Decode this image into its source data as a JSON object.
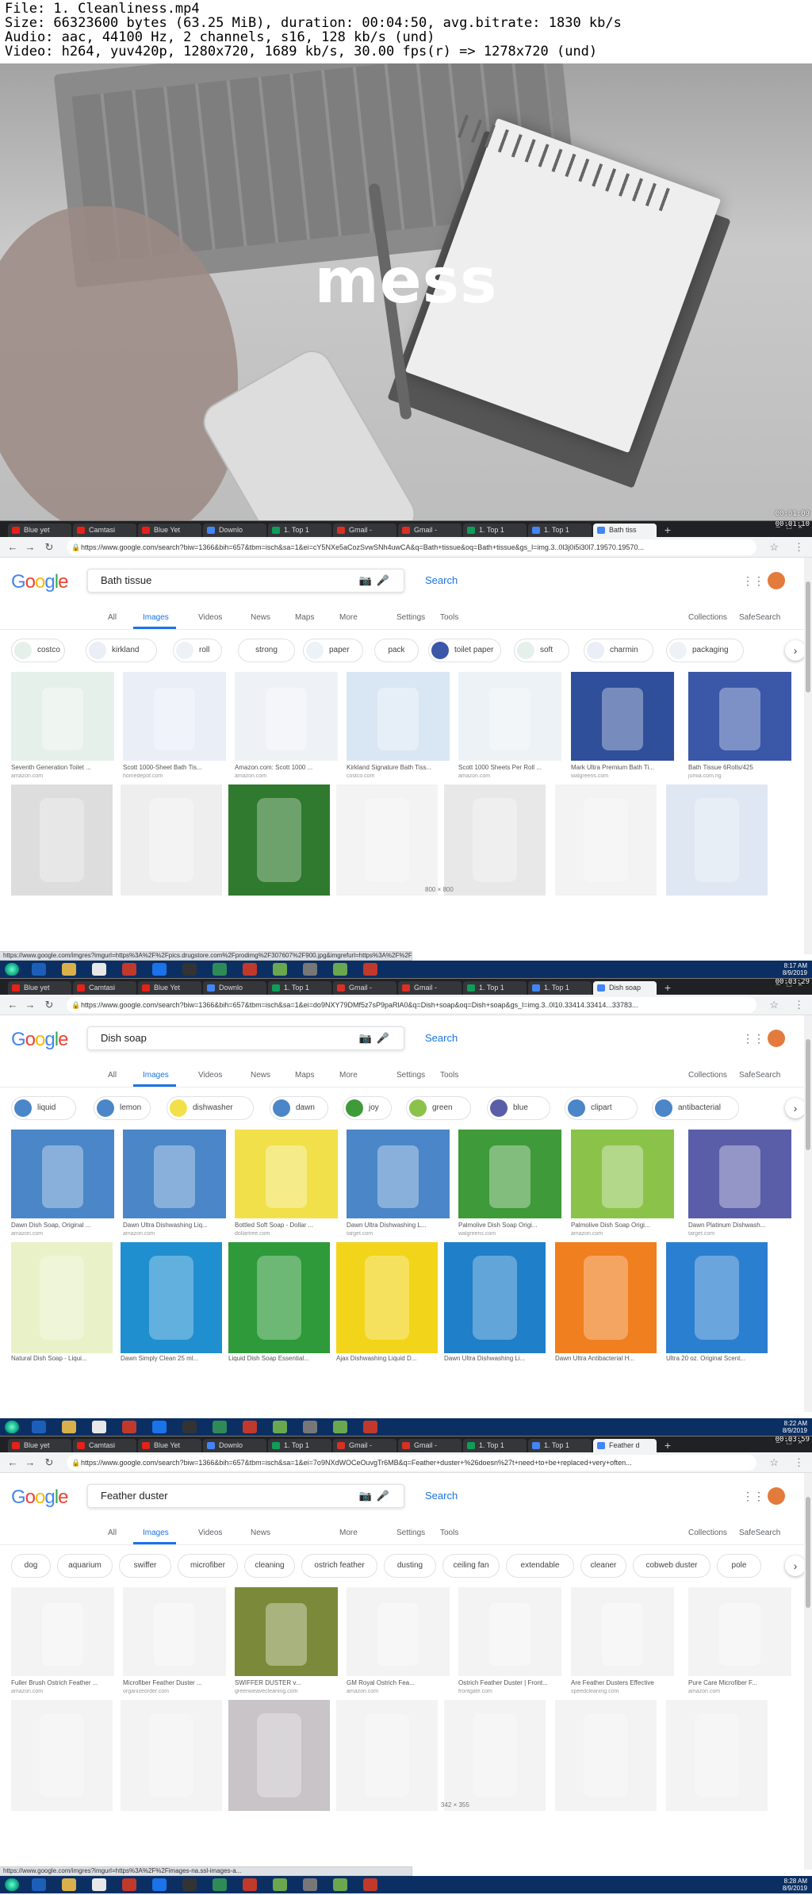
{
  "file_info": {
    "line1": "File: 1. Cleanliness.mp4",
    "line2": "Size: 66323600 bytes (63.25 MiB), duration: 00:04:50, avg.bitrate: 1830 kb/s",
    "line3": "Audio: aac, 44100 Hz, 2 channels, s16, 128 kb/s (und)",
    "line4": "Video: h264, yuv420p, 1280x720, 1689 kb/s, 30.00 fps(r) => 1278x720 (und)"
  },
  "hero": {
    "word": "mess",
    "timestamp": "00:01:09"
  },
  "panels": [
    {
      "timestamp": "00:01:10",
      "tabs": [
        "Blue yet",
        "Camtasi",
        "Blue Yet",
        "Downlo",
        "1. Top 1",
        "Gmail -",
        "Gmail -",
        "1. Top 1",
        "1. Top 1",
        "Bath tiss"
      ],
      "url": "https://www.google.com/search?biw=1366&bih=657&tbm=isch&sa=1&ei=cY5NXe5aCozSvwSNh4uwCA&q=Bath+tissue&oq=Bath+tissue&gs_l=img.3..0l3j0i5i30l7.19570.19570...",
      "query": "Bath tissue",
      "search": "Search",
      "nav": {
        "all": "All",
        "images": "Images",
        "videos": "Videos",
        "news": "News",
        "maps": "Maps",
        "more": "More",
        "settings": "Settings",
        "tools": "Tools",
        "collections": "Collections",
        "safesearch": "SafeSearch"
      },
      "chips": [
        "costco",
        "kirkland",
        "roll",
        "strong",
        "paper",
        "pack",
        "toilet paper",
        "soft",
        "charmin",
        "packaging"
      ],
      "row1": [
        {
          "cap": "Seventh Generation Toilet ...",
          "src": "amazon.com"
        },
        {
          "cap": "Scott 1000-Sheet Bath Tis...",
          "src": "homedepot.com"
        },
        {
          "cap": "Amazon.com: Scott 1000 ...",
          "src": "amazon.com"
        },
        {
          "cap": "Kirkland Signature Bath Tiss...",
          "src": "costco.com"
        },
        {
          "cap": "Scott 1000 Sheets Per Roll ...",
          "src": "amazon.com"
        },
        {
          "cap": "Mark Ultra Premium Bath Ti...",
          "src": "walgreens.com"
        },
        {
          "cap": "Bath Tissue 6Rolls/425",
          "src": "jumia.com.ng"
        }
      ],
      "hover_size": "800 × 800",
      "status": "https://www.google.com/imgres?imgurl=https%3A%2F%2Fpics.drugstore.com%2Fprodimg%2F307607%2F900.jpg&imgrefurl=https%3A%2F%2Fwww.walgreens.com%2Fstore%2Fc%2Fscott-1000-sheets-per-roll-toilet-paper-bath-tissue%2FID%3Dprod",
      "clock_time": "8:17 AM",
      "clock_date": "8/9/2019"
    },
    {
      "timestamp": "00:03:29",
      "tabs": [
        "Blue yet",
        "Camtasi",
        "Blue Yet",
        "Downlo",
        "1. Top 1",
        "Gmail -",
        "Gmail -",
        "1. Top 1",
        "1. Top 1",
        "Dish soap"
      ],
      "url": "https://www.google.com/search?biw=1366&bih=657&tbm=isch&sa=1&ei=do9NXY79DMf5z7sP9paRlA0&q=Dish+soap&oq=Dish+soap&gs_l=img.3..0l10.33414.33414...33783...",
      "query": "Dish soap",
      "search": "Search",
      "nav": {
        "all": "All",
        "images": "Images",
        "videos": "Videos",
        "news": "News",
        "maps": "Maps",
        "more": "More",
        "settings": "Settings",
        "tools": "Tools",
        "collections": "Collections",
        "safesearch": "SafeSearch"
      },
      "chips": [
        "liquid",
        "lemon",
        "dishwasher",
        "dawn",
        "joy",
        "green",
        "blue",
        "clipart",
        "antibacterial"
      ],
      "row1": [
        {
          "cap": "Dawn Dish Soap, Original ...",
          "src": "amazon.com"
        },
        {
          "cap": "Dawn Ultra Dishwashing Liq...",
          "src": "amazon.com"
        },
        {
          "cap": "Bottled Soft Soap - Dollar ...",
          "src": "dollartree.com"
        },
        {
          "cap": "Dawn Ultra Dishwashing L...",
          "src": "target.com"
        },
        {
          "cap": "Palmolive Dish Soap Origi...",
          "src": "walgreens.com"
        },
        {
          "cap": "Palmolive Dish Soap Origi...",
          "src": "amazon.com"
        },
        {
          "cap": "Dawn Platinum Dishwash...",
          "src": "target.com"
        }
      ],
      "row2caps": [
        "Natural Dish Soap - Liqui...",
        "Dawn Simply Clean 25 ml...",
        "Liquid Dish Soap Essential...",
        "Ajax Dishwashing Liquid D...",
        "Dawn Ultra Dishwashing Li...",
        "Dawn Ultra Antibacterial H...",
        "Ultra 20 oz. Original Scent..."
      ],
      "clock_time": "8:22 AM",
      "clock_date": "8/9/2019"
    },
    {
      "timestamp": "00:03:59",
      "tabs": [
        "Blue yet",
        "Camtasi",
        "Blue Yet",
        "Downlo",
        "1. Top 1",
        "Gmail -",
        "Gmail -",
        "1. Top 1",
        "1. Top 1",
        "Feather d"
      ],
      "url": "https://www.google.com/search?biw=1366&bih=657&tbm=isch&sa=1&ei=7o9NXdWOCeOuvgTr6MB&q=Feather+duster+%26doesn%27t+need+to+be+replaced+very+often...",
      "query": "Feather duster",
      "search": "Search",
      "nav": {
        "all": "All",
        "images": "Images",
        "videos": "Videos",
        "news": "News",
        "maps": "",
        "more": "More",
        "settings": "Settings",
        "tools": "Tools",
        "collections": "Collections",
        "safesearch": "SafeSearch"
      },
      "chips": [
        "dog",
        "aquarium",
        "swiffer",
        "microfiber",
        "cleaning",
        "ostrich feather",
        "dusting",
        "ceiling fan",
        "extendable",
        "cleaner",
        "cobweb duster",
        "pole"
      ],
      "row1": [
        {
          "cap": "Fuller Brush Ostrich Feather ...",
          "src": "amazon.com"
        },
        {
          "cap": "Microfiber Feather Duster ...",
          "src": "organizeorder.com"
        },
        {
          "cap": "SWIFFER DUSTER v...",
          "src": "greenweavecleaning.com"
        },
        {
          "cap": "GM Royal Ostrich Fea...",
          "src": "amazon.com"
        },
        {
          "cap": "Ostrich Feather Duster | Front...",
          "src": "frontgate.com"
        },
        {
          "cap": "Are Feather Dusters Effective",
          "src": "speedcleaning.com"
        },
        {
          "cap": "Pure Care Microfiber F...",
          "src": "amazon.com"
        }
      ],
      "hover_size": "342 × 355",
      "status": "https://www.google.com/imgres?imgurl=https%3A%2F%2Fimages-na.ssl-images-a...",
      "clock_time": "8:28 AM",
      "clock_date": "8/9/2019"
    }
  ],
  "colors": {
    "taskbar": "#0b2f63",
    "tabbar": "#202124",
    "google_blue": "#4285f4",
    "google_red": "#ea4335",
    "google_yellow": "#fbbc05",
    "google_green": "#34a853"
  }
}
